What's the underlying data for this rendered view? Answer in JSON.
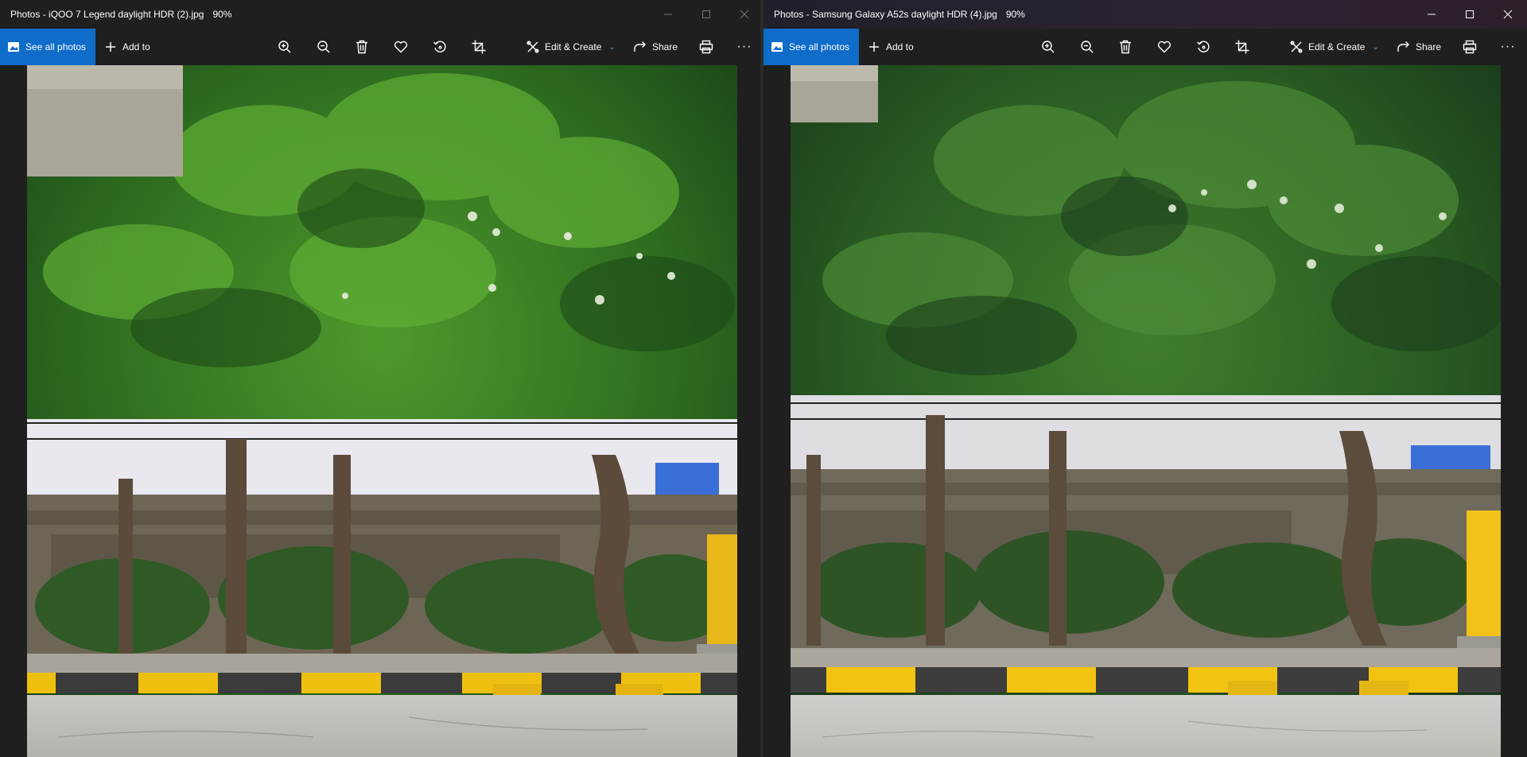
{
  "windows": [
    {
      "title": "Photos - iQOO 7 Legend daylight HDR (2).jpg",
      "zoom": "90%",
      "toolbar": {
        "see_all_label": "See all photos",
        "add_to_label": "Add to",
        "edit_create_label": "Edit & Create",
        "share_label": "Share",
        "more_label": "···"
      }
    },
    {
      "title": "Photos - Samsung Galaxy A52s daylight HDR (4).jpg",
      "zoom": "90%",
      "toolbar": {
        "see_all_label": "See all photos",
        "add_to_label": "Add to",
        "edit_create_label": "Edit & Create",
        "share_label": "Share",
        "more_label": "···"
      }
    }
  ],
  "icons": {
    "photos_app": "photos-app-icon",
    "add": "plus-icon",
    "zoom_in": "zoom-in-icon",
    "zoom_out": "zoom-out-icon",
    "delete": "trash-icon",
    "favorite": "heart-icon",
    "rotate": "rotate-icon",
    "crop": "crop-icon",
    "edit_create": "edit-create-icon",
    "chevron": "chevron-down-icon",
    "share": "share-icon",
    "print": "print-icon",
    "more": "more-icon",
    "minimize": "minimize-icon",
    "maximize": "maximize-icon",
    "close": "close-icon"
  },
  "colors": {
    "accent": "#0f6cc8",
    "background": "#1f1f1f"
  }
}
